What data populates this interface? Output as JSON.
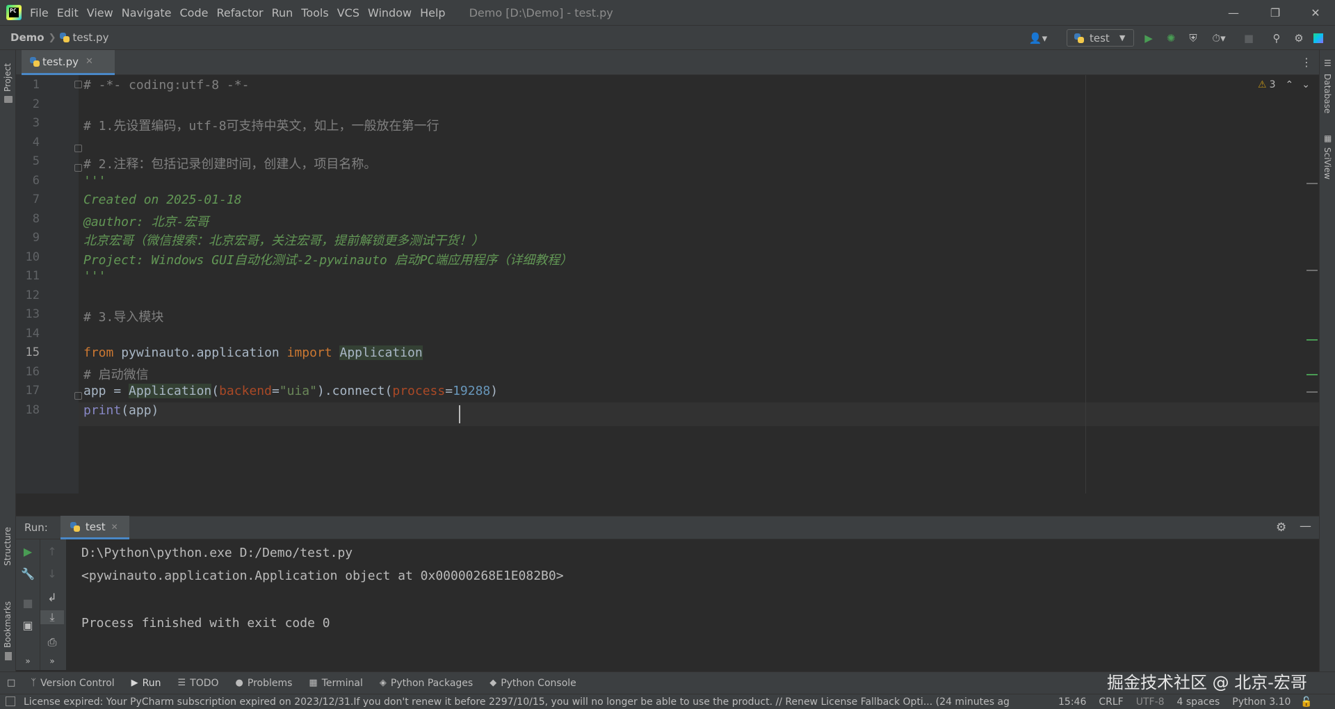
{
  "menu": [
    "File",
    "Edit",
    "View",
    "Navigate",
    "Code",
    "Refactor",
    "Run",
    "Tools",
    "VCS",
    "Window",
    "Help"
  ],
  "window_title": "Demo [D:\\Demo] - test.py",
  "breadcrumb": {
    "project": "Demo",
    "file": "test.py"
  },
  "run_config": {
    "name": "test"
  },
  "left_strip": {
    "project": "Project",
    "structure": "Structure",
    "bookmarks": "Bookmarks"
  },
  "right_strip": {
    "database": "Database",
    "sciview": "SciView"
  },
  "editor_tab": {
    "label": "test.py"
  },
  "inspection": {
    "warnings": "3"
  },
  "code_lines": [
    {
      "n": "1",
      "y": 0
    },
    {
      "n": "2",
      "y": 1
    },
    {
      "n": "3",
      "y": 2
    },
    {
      "n": "4",
      "y": 3
    },
    {
      "n": "5",
      "y": 4
    },
    {
      "n": "6",
      "y": 5
    },
    {
      "n": "7",
      "y": 6
    },
    {
      "n": "8",
      "y": 7
    },
    {
      "n": "9",
      "y": 8
    },
    {
      "n": "10",
      "y": 9
    },
    {
      "n": "11",
      "y": 10
    },
    {
      "n": "12",
      "y": 11
    },
    {
      "n": "13",
      "y": 12
    },
    {
      "n": "14",
      "y": 13
    },
    {
      "n": "15",
      "y": 14
    },
    {
      "n": "16",
      "y": 15
    },
    {
      "n": "17",
      "y": 16
    },
    {
      "n": "18",
      "y": 17
    }
  ],
  "code": {
    "l1": "# -*- coding:utf-8 -*-",
    "l3": "# 1.先设置编码，utf-8可支持中英文，如上，一般放在第一行",
    "l5": "# 2.注释：包括记录创建时间，创建人，项目名称。",
    "l6": "'''",
    "l7": "Created on 2025-01-18",
    "l8": "@author: 北京-宏哥",
    "l9": "北京宏哥（微信搜索：北京宏哥，关注宏哥，提前解锁更多测试干货！）",
    "l10": "Project: Windows GUI自动化测试-2-pywinauto 启动PC端应用程序（详细教程）",
    "l11": "'''",
    "l13": "# 3.导入模块",
    "l15_kw1": "from",
    "l15_mod": " pywinauto.application ",
    "l15_kw2": "import",
    "l15_cls": "Application",
    "l16": "# 启动微信",
    "l17_a": "app = ",
    "l17_cls": "Application",
    "l17_b": "(",
    "l17_p1": "backend",
    "l17_eq1": "=",
    "l17_s": "\"uia\"",
    "l17_c": ").connect(",
    "l17_p2": "process",
    "l17_eq2": "=",
    "l17_n": "19288",
    "l17_d": ")",
    "l18_fn": "print",
    "l18_rest": "(app)"
  },
  "run_panel": {
    "label": "Run:",
    "tab": "test",
    "output": [
      "D:\\Python\\python.exe D:/Demo/test.py",
      "<pywinauto.application.Application object at 0x00000268E1E082B0>",
      "",
      "Process finished with exit code 0"
    ]
  },
  "tool_tabs": [
    {
      "label": "Version Control",
      "icon": "branch-icon"
    },
    {
      "label": "Run",
      "icon": "play-icon"
    },
    {
      "label": "TODO",
      "icon": "list-icon"
    },
    {
      "label": "Problems",
      "icon": "problems-icon"
    },
    {
      "label": "Terminal",
      "icon": "terminal-icon"
    },
    {
      "label": "Python Packages",
      "icon": "packages-icon"
    },
    {
      "label": "Python Console",
      "icon": "console-icon"
    }
  ],
  "status": {
    "message": "License expired: Your PyCharm subscription expired on 2023/12/31.If you don't renew it before 2297/10/15, you will no longer be able to use the product. // Renew License   Fallback Opti... (24 minutes ag",
    "position": "15:46",
    "line_sep": "CRLF",
    "encoding": "UTF-8",
    "indent": "4 spaces",
    "interpreter": "Python 3.10"
  },
  "watermark": "掘金技术社区 @ 北京-宏哥",
  "colors": {
    "accent": "#4a88c7",
    "keyword": "#cc7832",
    "docstring": "#629755",
    "comment": "#808080",
    "number": "#6897bb",
    "string": "#6a8759",
    "run_green": "#499c54"
  }
}
